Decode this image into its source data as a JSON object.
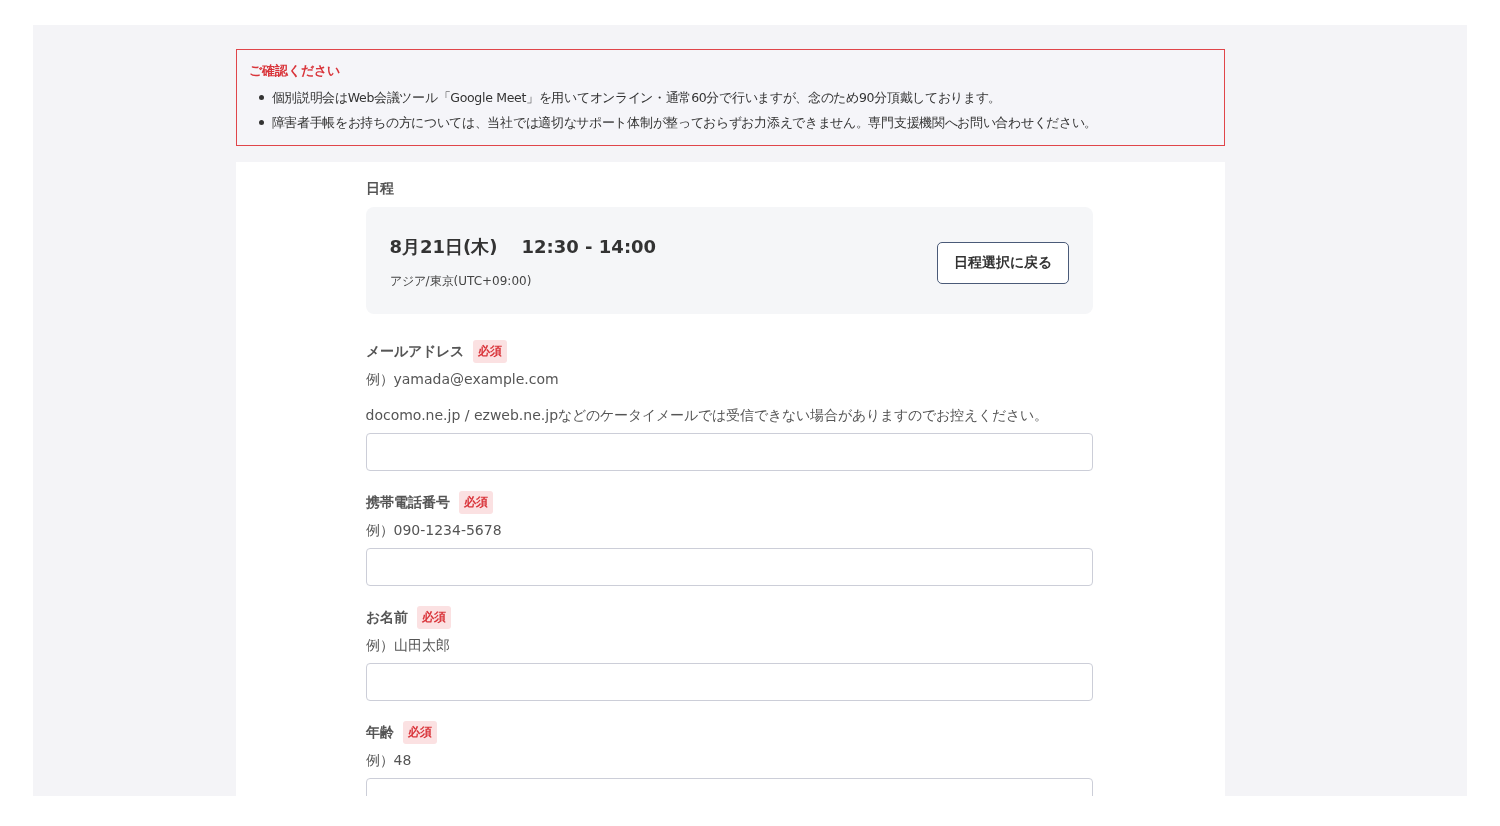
{
  "notice": {
    "title": "ご確認ください",
    "items": [
      "個別説明会はWeb会議ツール「Google Meet」を用いてオンライン・通常60分で行いますが、念のため90分頂戴しております。",
      "障害者手帳をお持ちの方については、当社では適切なサポート体制が整っておらずお力添えできません。専門支援機関へお問い合わせください。"
    ]
  },
  "schedule": {
    "label": "日程",
    "date": "8月21日(木)",
    "time": "12:30 - 14:00",
    "timezone": "アジア/東京(UTC+09:00)",
    "back_button": "日程選択に戻る"
  },
  "fields": [
    {
      "label": "メールアドレス",
      "required": true,
      "required_badge": "必須",
      "hints": [
        "例）yamada@example.com",
        "docomo.ne.jp / ezweb.ne.jpなどのケータイメールでは受信できない場合がありますのでお控えください。"
      ]
    },
    {
      "label": "携帯電話番号",
      "required": true,
      "required_badge": "必須",
      "hints": [
        "例）090-1234-5678"
      ]
    },
    {
      "label": "お名前",
      "required": true,
      "required_badge": "必須",
      "hints": [
        "例）山田太郎"
      ]
    },
    {
      "label": "年齢",
      "required": true,
      "required_badge": "必須",
      "hints": [
        "例）48"
      ]
    }
  ]
}
